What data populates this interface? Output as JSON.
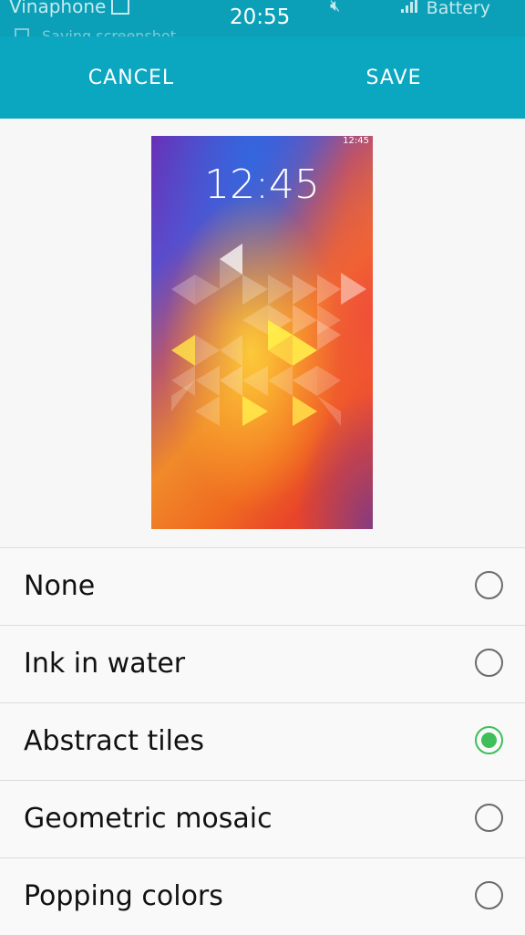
{
  "status_bar": {
    "carrier": "Vinaphone",
    "time": "20:55",
    "battery_label": "Battery",
    "notice": "Saving screenshot"
  },
  "action_bar": {
    "cancel_label": "CANCEL",
    "save_label": "SAVE"
  },
  "preview": {
    "time": "12:45",
    "status_time": "12:45"
  },
  "options": [
    {
      "label": "None",
      "selected": false
    },
    {
      "label": "Ink in water",
      "selected": false
    },
    {
      "label": "Abstract tiles",
      "selected": true
    },
    {
      "label": "Geometric mosaic",
      "selected": false
    },
    {
      "label": "Popping colors",
      "selected": false
    }
  ],
  "colors": {
    "accent": "#0ba6c0",
    "radio_selected": "#3fbf5a"
  }
}
